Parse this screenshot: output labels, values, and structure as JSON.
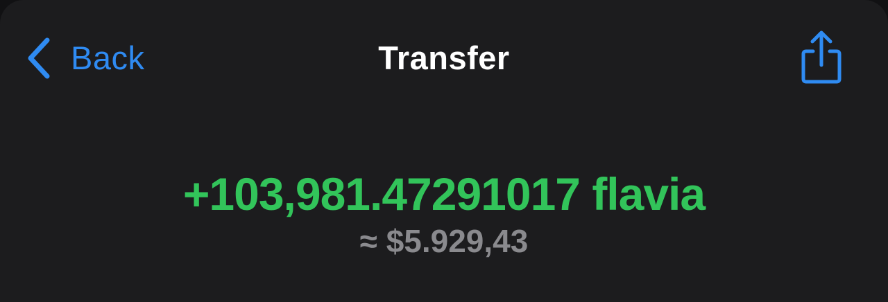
{
  "nav": {
    "back_label": "Back",
    "title": "Transfer",
    "share_icon": "share-icon"
  },
  "transfer": {
    "amount": "+103,981.47291017",
    "token": "flavia",
    "fiat_approx_symbol": "≈",
    "fiat_value": "$5.929,43"
  },
  "colors": {
    "background": "#1c1c1e",
    "accent_blue": "#2f8bf2",
    "amount_green": "#32c45a",
    "secondary_gray": "#8a8a8e",
    "title_white": "#ffffff"
  }
}
